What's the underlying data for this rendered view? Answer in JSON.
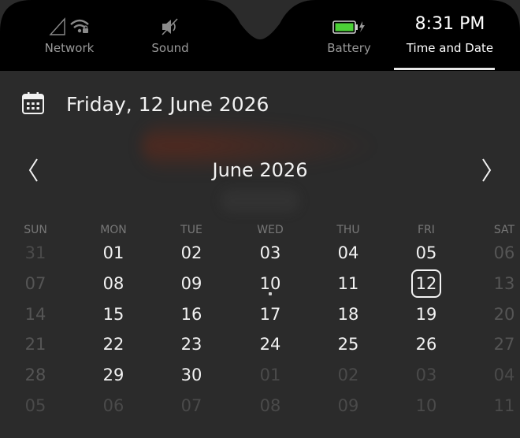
{
  "indicators": [
    {
      "id": "network",
      "label": "Network",
      "icon": "network-icon"
    },
    {
      "id": "sound",
      "label": "Sound",
      "icon": "sound-muted-icon"
    },
    {
      "id": "battery",
      "label": "Battery",
      "icon": "battery-charging-icon"
    },
    {
      "id": "time",
      "label": "Time and Date",
      "time": "8:31 PM"
    }
  ],
  "colors": {
    "battery_fill": "#4cd137",
    "accent_text": "#ffffff",
    "dim_text": "#555555"
  },
  "panel": {
    "selected_date": "Friday, 12 June 2026",
    "month_title": "June 2026",
    "weekdays": [
      "SUN",
      "MON",
      "TUE",
      "WED",
      "THU",
      "FRI",
      "SAT"
    ],
    "weeks": [
      [
        "31",
        "01",
        "02",
        "03",
        "04",
        "05",
        "06"
      ],
      [
        "07",
        "08",
        "09",
        "10",
        "11",
        "12",
        "13"
      ],
      [
        "14",
        "15",
        "16",
        "17",
        "18",
        "19",
        "20"
      ],
      [
        "21",
        "22",
        "23",
        "24",
        "25",
        "26",
        "27"
      ],
      [
        "28",
        "29",
        "30",
        "01",
        "02",
        "03",
        "04"
      ],
      [
        "05",
        "06",
        "07",
        "08",
        "09",
        "10",
        "11"
      ]
    ]
  }
}
